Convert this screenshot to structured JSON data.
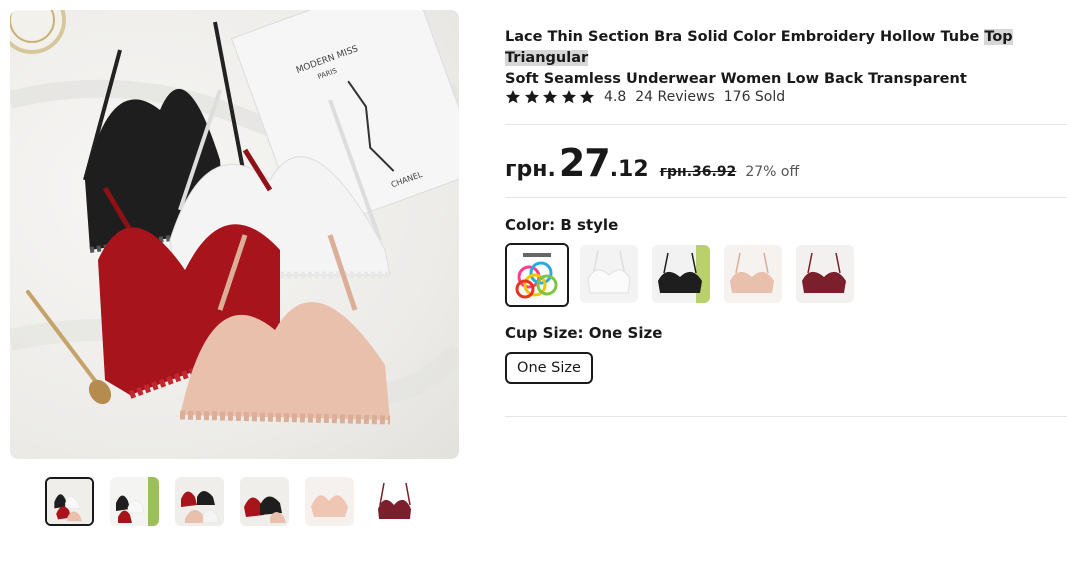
{
  "product": {
    "title_part1": "Lace Thin Section Bra Solid Color Embroidery Hollow Tube ",
    "title_highlight": "Top Triangular",
    "title_part2": "Soft Seamless Underwear Women Low Back Transparent"
  },
  "rating": {
    "stars": 5,
    "value": "4.8",
    "reviews": "24 Reviews",
    "sold": "176 Sold"
  },
  "price": {
    "currency": "грн.",
    "integer": "27",
    "decimal": ".12",
    "original": "грн.36.92",
    "discount": "27% off"
  },
  "color": {
    "label": "Color: ",
    "selected": "B style",
    "options": [
      "B style",
      "white",
      "black",
      "nude",
      "wine red"
    ],
    "selected_index": 0
  },
  "cup_size": {
    "label": "Cup Size: ",
    "selected": "One Size",
    "options": [
      "One Size"
    ]
  },
  "gallery": {
    "main_image_text": {
      "box_line1": "MODERN MISS",
      "box_line2": "PARIS",
      "box_brand": "CHANEL"
    },
    "thumbnails_count": 6,
    "active_index": 0
  },
  "colors": {
    "text": "#191919",
    "divider": "#e5e5e5",
    "star": "#191919",
    "black_bra": "#1e1e1e",
    "white_bra": "#f4f4f4",
    "red_bra": "#a8141c",
    "nude_bra": "#e9c0ac",
    "wine_bra": "#7a1f2b"
  }
}
